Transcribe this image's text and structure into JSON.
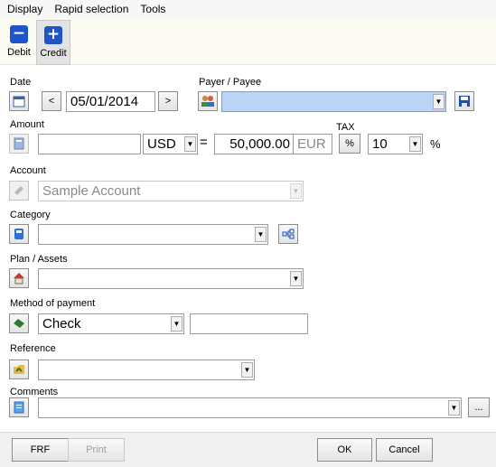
{
  "menu": [
    "Display",
    "Rapid selection",
    "Tools"
  ],
  "toolbar": {
    "debit_label": "Debit",
    "credit_label": "Credit",
    "debit_symbol": "−",
    "credit_symbol": "+"
  },
  "date": {
    "label": "Date",
    "value": "05/01/2014",
    "prev": "<",
    "next": ">"
  },
  "payee": {
    "label": "Payer / Payee",
    "value": ""
  },
  "amount": {
    "label": "Amount",
    "value": "",
    "currency": "USD",
    "equals": "=",
    "converted": "50,000.00",
    "converted_currency": "EUR"
  },
  "tax": {
    "label": "TAX",
    "button": "%",
    "value": "10",
    "unit": "%"
  },
  "account": {
    "label": "Account",
    "value": "Sample Account"
  },
  "category": {
    "label": "Category",
    "value": ""
  },
  "plan": {
    "label": "Plan / Assets",
    "value": ""
  },
  "payment": {
    "label": "Method of payment",
    "value": "Check",
    "number": ""
  },
  "reference": {
    "label": "Reference",
    "value": ""
  },
  "comments": {
    "label": "Comments",
    "value": "",
    "more": "..."
  },
  "buttons": {
    "frf": "FRF",
    "print": "Print",
    "ok": "OK",
    "cancel": "Cancel"
  },
  "colors": {
    "accent": "#1f55c9",
    "highlight": "#bcd3f8"
  }
}
